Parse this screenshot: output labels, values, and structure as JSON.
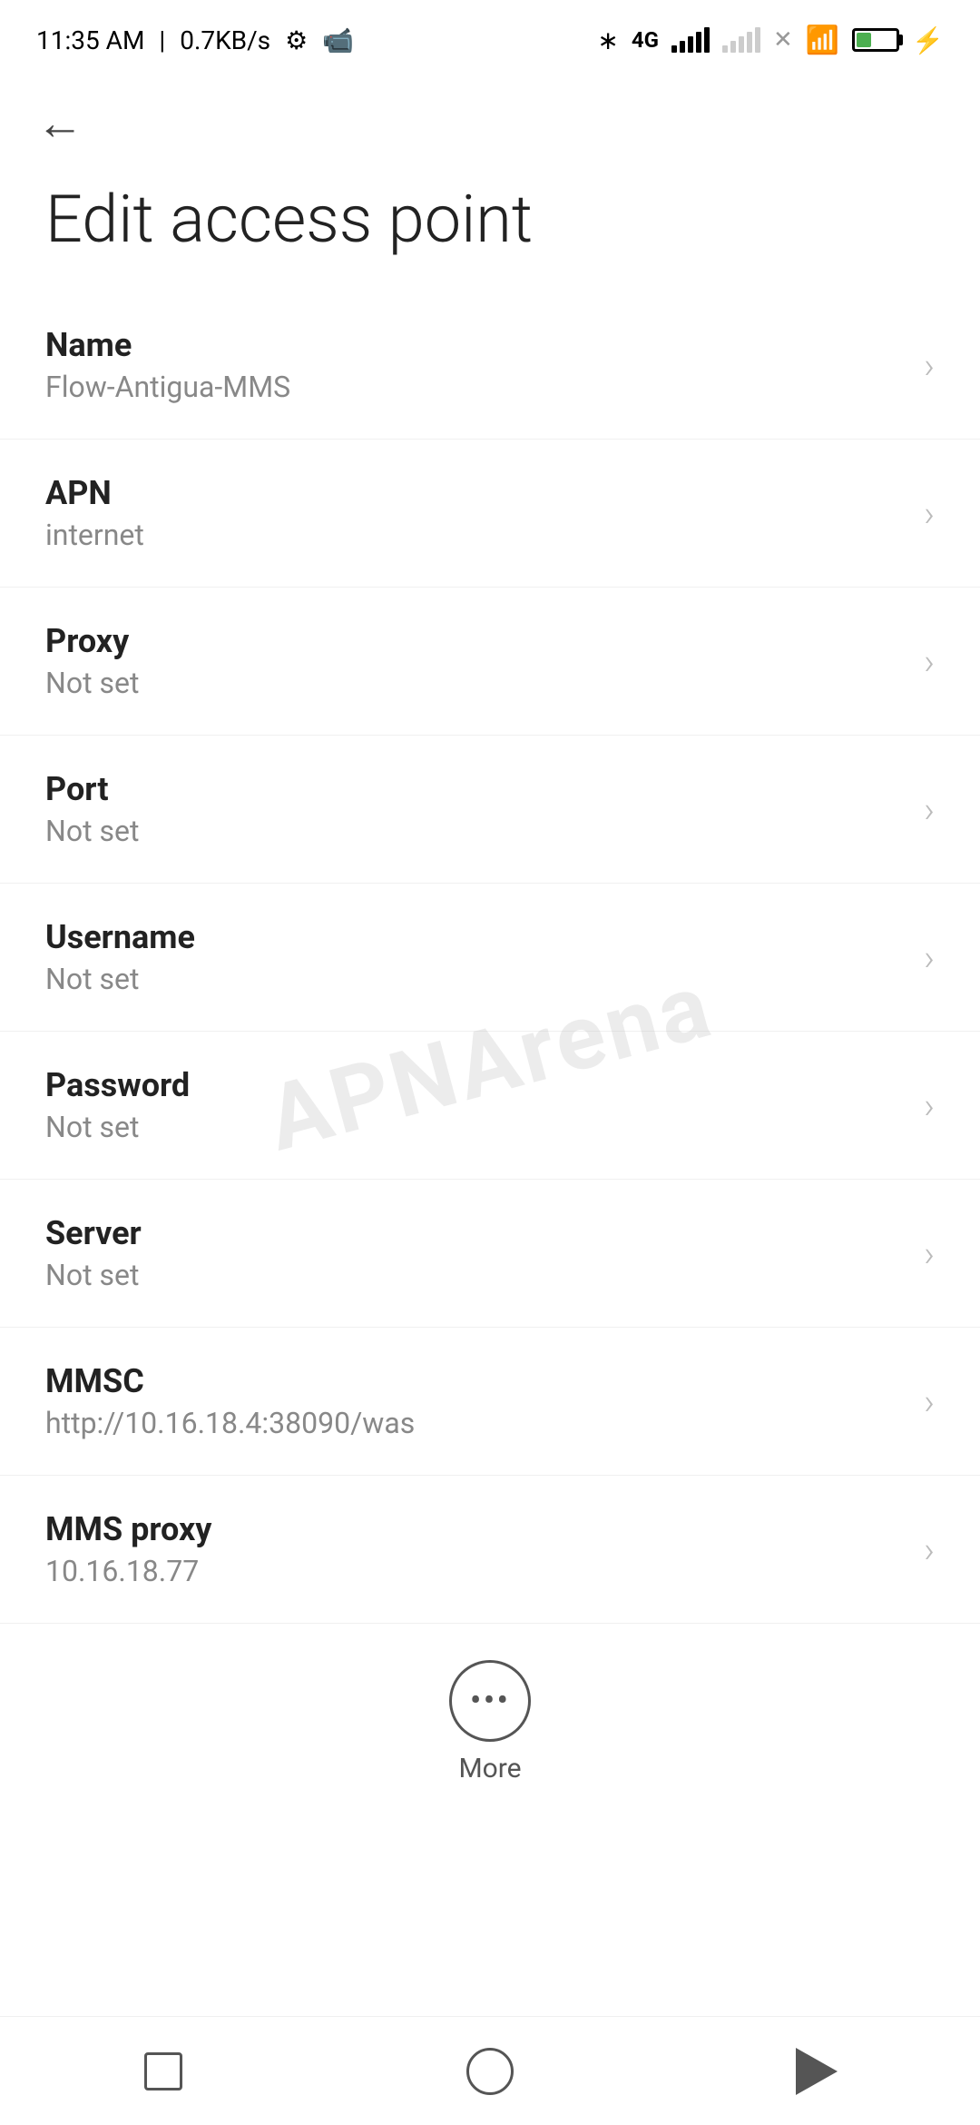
{
  "statusBar": {
    "time": "11:35 AM",
    "speed": "0.7KB/s",
    "battery_percent": "38"
  },
  "header": {
    "back_label": "←",
    "title": "Edit access point"
  },
  "settings": {
    "items": [
      {
        "id": "name",
        "label": "Name",
        "value": "Flow-Antigua-MMS"
      },
      {
        "id": "apn",
        "label": "APN",
        "value": "internet"
      },
      {
        "id": "proxy",
        "label": "Proxy",
        "value": "Not set"
      },
      {
        "id": "port",
        "label": "Port",
        "value": "Not set"
      },
      {
        "id": "username",
        "label": "Username",
        "value": "Not set"
      },
      {
        "id": "password",
        "label": "Password",
        "value": "Not set"
      },
      {
        "id": "server",
        "label": "Server",
        "value": "Not set"
      },
      {
        "id": "mmsc",
        "label": "MMSC",
        "value": "http://10.16.18.4:38090/was"
      },
      {
        "id": "mms-proxy",
        "label": "MMS proxy",
        "value": "10.16.18.77"
      }
    ]
  },
  "more_button": {
    "label": "More"
  },
  "watermark": "APNArena"
}
